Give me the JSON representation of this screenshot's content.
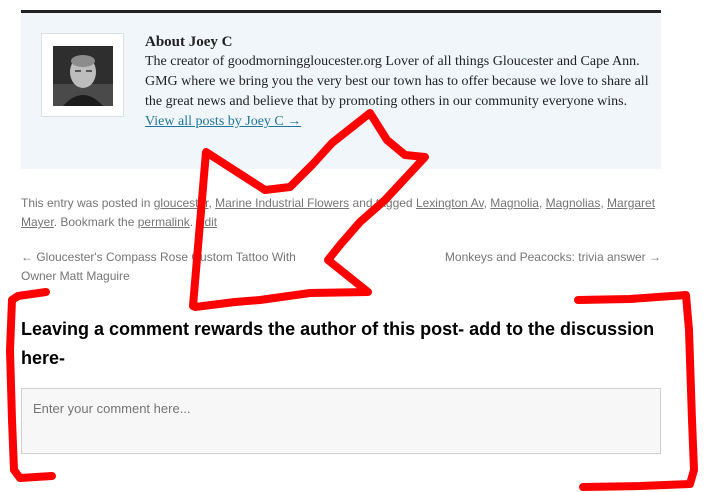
{
  "author": {
    "name": "About Joey C",
    "description": "The creator of goodmorninggloucester.org Lover of all things Gloucester and Cape Ann. GMG where we bring you the very best our town has to offer because we love to share all the great news and believe that by promoting others in our community everyone wins.",
    "view_all_link": "View all posts by Joey C →"
  },
  "meta": {
    "prefix": "This entry was posted in",
    "categories": [
      "gloucester",
      "Marine Industrial Flowers"
    ],
    "sep_comma": ",",
    "tagged_text": "and tagged",
    "tags": [
      "Lexington Av",
      "Magnolia",
      "Magnolias",
      "Margaret Mayer"
    ],
    "bookmark_text": ". Bookmark the",
    "permalink": "permalink",
    "edit": "Edit"
  },
  "post_nav": {
    "prev": "← Gloucester's Compass Rose Custom Tattoo With Owner Matt Maguire",
    "next": "Monkeys and Peacocks: trivia answer →"
  },
  "comments": {
    "heading": "Leaving a comment rewards the author of this post- add to the discussion here-",
    "placeholder": "Enter your comment here..."
  },
  "colors": {
    "link": "#21759b",
    "author_box_bg": "#f1f6fa",
    "annotation": "#ff0000"
  }
}
